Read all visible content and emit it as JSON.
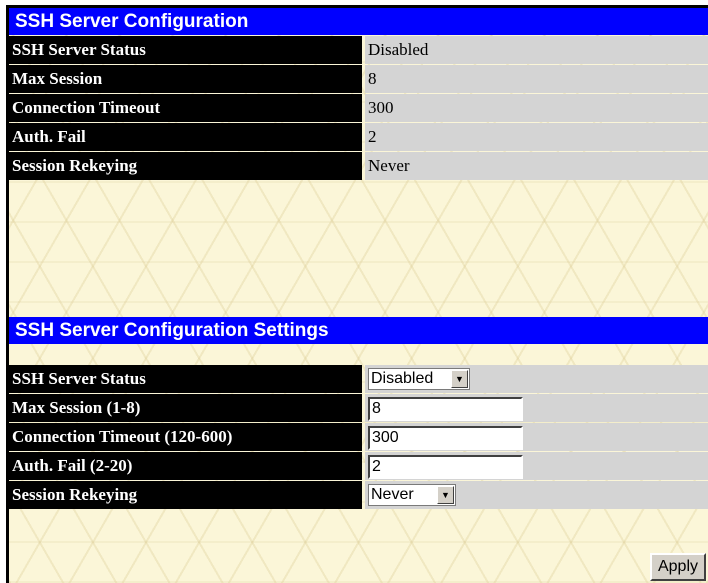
{
  "status_section": {
    "title": "SSH Server Configuration",
    "rows": [
      {
        "label": "SSH Server Status",
        "value": "Disabled"
      },
      {
        "label": "Max Session",
        "value": "8"
      },
      {
        "label": "Connection Timeout",
        "value": "300"
      },
      {
        "label": "Auth. Fail",
        "value": "2"
      },
      {
        "label": "Session Rekeying",
        "value": "Never"
      }
    ]
  },
  "settings_section": {
    "title": "SSH Server Configuration Settings",
    "ssh_server_status": {
      "label": "SSH Server Status",
      "selected": "Disabled"
    },
    "max_session": {
      "label": "Max Session (1-8)",
      "value": "8"
    },
    "connection_timeout": {
      "label": "Connection Timeout (120-600)",
      "value": "300"
    },
    "auth_fail": {
      "label": "Auth. Fail (2-20)",
      "value": "2"
    },
    "session_rekeying": {
      "label": "Session Rekeying",
      "selected": "Never"
    },
    "apply_label": "Apply"
  },
  "colors": {
    "header_bg": "#0000ff",
    "label_bg": "#000000",
    "value_bg": "#d4d4d4",
    "page_bg": "#fbf6d8"
  },
  "icons": {
    "dropdown": "chevron-down-icon"
  }
}
